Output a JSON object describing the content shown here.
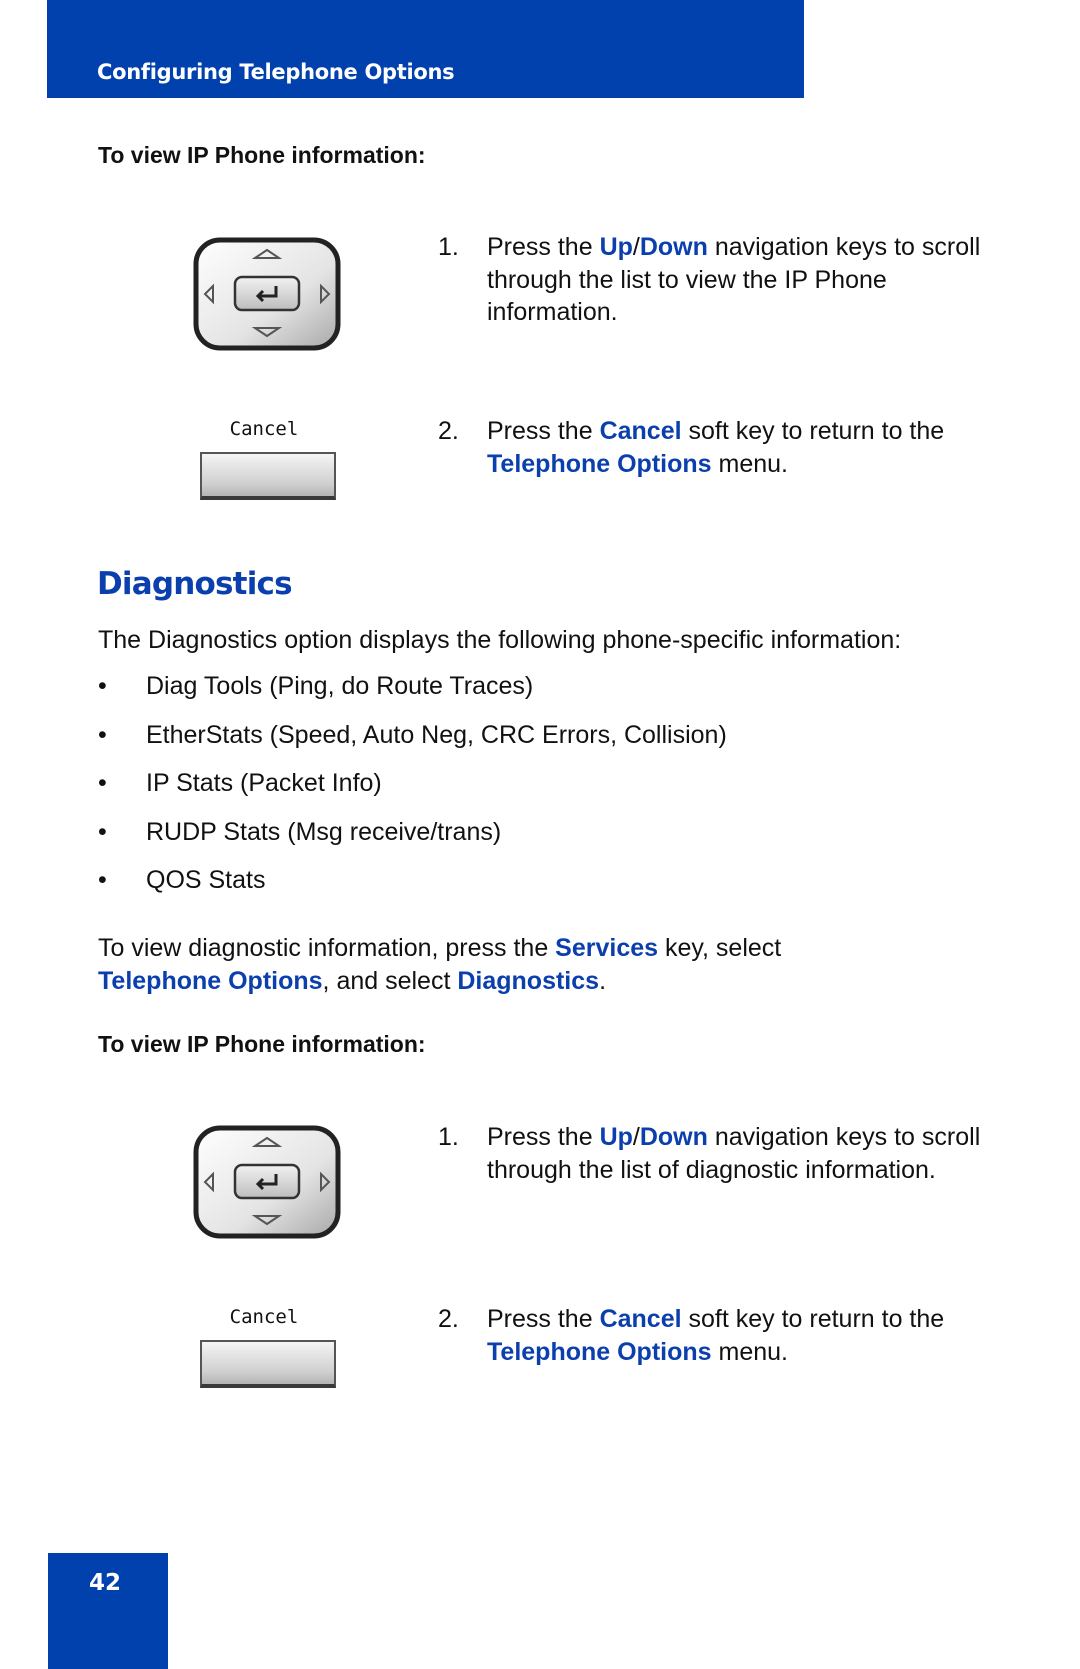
{
  "header": {
    "title": "Configuring Telephone Options"
  },
  "procedure1": {
    "heading": "To view IP Phone information:",
    "step1": {
      "num": "1.",
      "pre": "Press the ",
      "up": "Up",
      "slash": "/",
      "down": "Down",
      "post": " navigation keys to scroll through the list to view the IP Phone information."
    },
    "step2": {
      "num": "2.",
      "pre": "Press the ",
      "key": "Cancel",
      "mid": " soft key to return to the ",
      "menu": "Telephone Options",
      "post": " menu."
    },
    "softkey_label": "Cancel"
  },
  "section": {
    "title": "Diagnostics",
    "intro": "The Diagnostics option displays the following phone-specific information:",
    "bullet_char": "•",
    "bullets": [
      "Diag Tools (Ping, do Route Traces)",
      "EtherStats (Speed, Auto Neg, CRC Errors, Collision)",
      "IP Stats (Packet Info)",
      "RUDP Stats (Msg receive/trans)",
      "QOS Stats"
    ],
    "howto": {
      "pre": "To view diagnostic information, press the ",
      "services": "Services",
      "mid": " key, select ",
      "options": "Telephone Options",
      "mid2": ", and select ",
      "diag": "Diagnostics",
      "post": "."
    }
  },
  "procedure2": {
    "heading": "To view IP Phone information:",
    "step1": {
      "num": "1.",
      "pre": "Press the ",
      "up": "Up",
      "slash": "/",
      "down": "Down",
      "post": " navigation keys to scroll through the list of diagnostic information."
    },
    "step2": {
      "num": "2.",
      "pre": "Press the ",
      "key": "Cancel",
      "mid": " soft key to return to the ",
      "menu": "Telephone Options",
      "post": " menu."
    },
    "softkey_label": "Cancel"
  },
  "footer": {
    "page_number": "42"
  },
  "colors": {
    "brand_blue": "#0041ad",
    "highlight_blue": "#0b3fae"
  }
}
